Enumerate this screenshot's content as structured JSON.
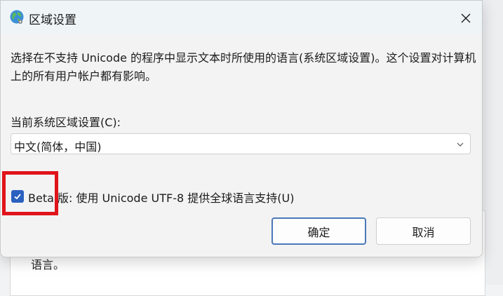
{
  "dialog": {
    "title": "区域设置",
    "description": "选择在不支持 Unicode 的程序中显示文本时所使用的语言(系统区域设置)。这个设置对计算机上的所有用户帐户都有影响。",
    "locale_label": "当前系统区域设置(C):",
    "locale_value": "中文(简体，中国)",
    "beta_checkbox_label": "Beta 版: 使用 Unicode UTF-8 提供全球语言支持(U)",
    "beta_checked": true,
    "ok_label": "确定",
    "cancel_label": "取消"
  },
  "background": {
    "partial_text": "语言。"
  },
  "colors": {
    "accent": "#2a60c0",
    "highlight": "#e0141a"
  },
  "icons": {
    "title": "globe-icon",
    "close": "close-icon",
    "chevron": "chevron-down-icon",
    "check": "checkmark-icon"
  }
}
